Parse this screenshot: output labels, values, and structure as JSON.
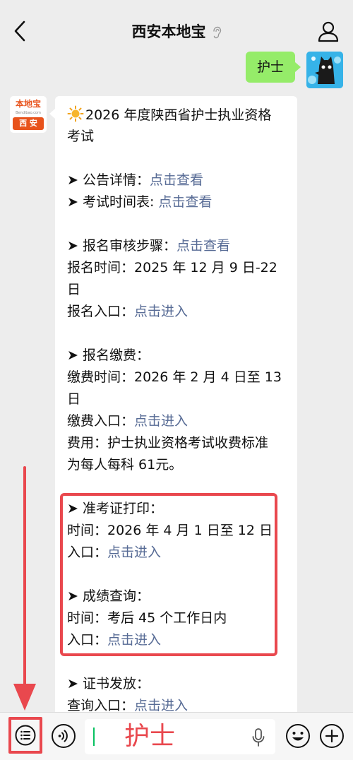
{
  "header": {
    "title": "西安本地宝"
  },
  "outgoing_message": {
    "text": "护士"
  },
  "account_avatar": {
    "top_text": "本地宝",
    "mid_text": "Bendibao.com",
    "bottom_text": "西 安"
  },
  "message": {
    "title_line1": "2026 年度陕西省护士执业资格",
    "title_line2": "考试",
    "announcement_label": "➤ 公告详情：",
    "announcement_link": "点击查看",
    "schedule_label": "➤ 考试时间表: ",
    "schedule_link": "点击查看",
    "review_label": "➤ 报名审核步骤：",
    "review_link": "点击查看",
    "reg_time_line1": "报名时间：2025 年 12 月 9 日-22",
    "reg_time_line2": "日",
    "reg_entry_label": "报名入口：",
    "reg_entry_link": "点击进入",
    "fee_heading": "➤ 报名缴费：",
    "fee_time_line1": "缴费时间：2026 年 2 月 4 日至 13",
    "fee_time_line2": "日",
    "fee_entry_label": "缴费入口：",
    "fee_entry_link": "点击进入",
    "fee_note_line1": "费用：护士执业资格考试收费标准",
    "fee_note_line2": "为每人每科 61元。",
    "admit_heading": "➤ 准考证打印：",
    "admit_time": "时间：2026 年 4 月 1 日至 12 日",
    "admit_entry_label": "入口：",
    "admit_entry_link": "点击进入",
    "score_heading": "➤ 成绩查询：",
    "score_time": "时间：考后 45 个工作日内",
    "score_entry_label": "入口：",
    "score_entry_link": "点击进入",
    "cert_heading": "➤ 证书发放：",
    "cert_entry_label": "查询入口：",
    "cert_entry_link": "点击进入"
  },
  "input_bar": {
    "text": "护士"
  },
  "colors": {
    "link": "#576b95",
    "highlight": "#e9484e",
    "outgoing_bubble": "#95ec69",
    "accent_green": "#07c160"
  },
  "icons": [
    "back-icon",
    "ear-icon",
    "profile-icon",
    "sun-icon",
    "menu-icon",
    "voice-icon",
    "mic-icon",
    "emoji-icon",
    "plus-icon"
  ]
}
